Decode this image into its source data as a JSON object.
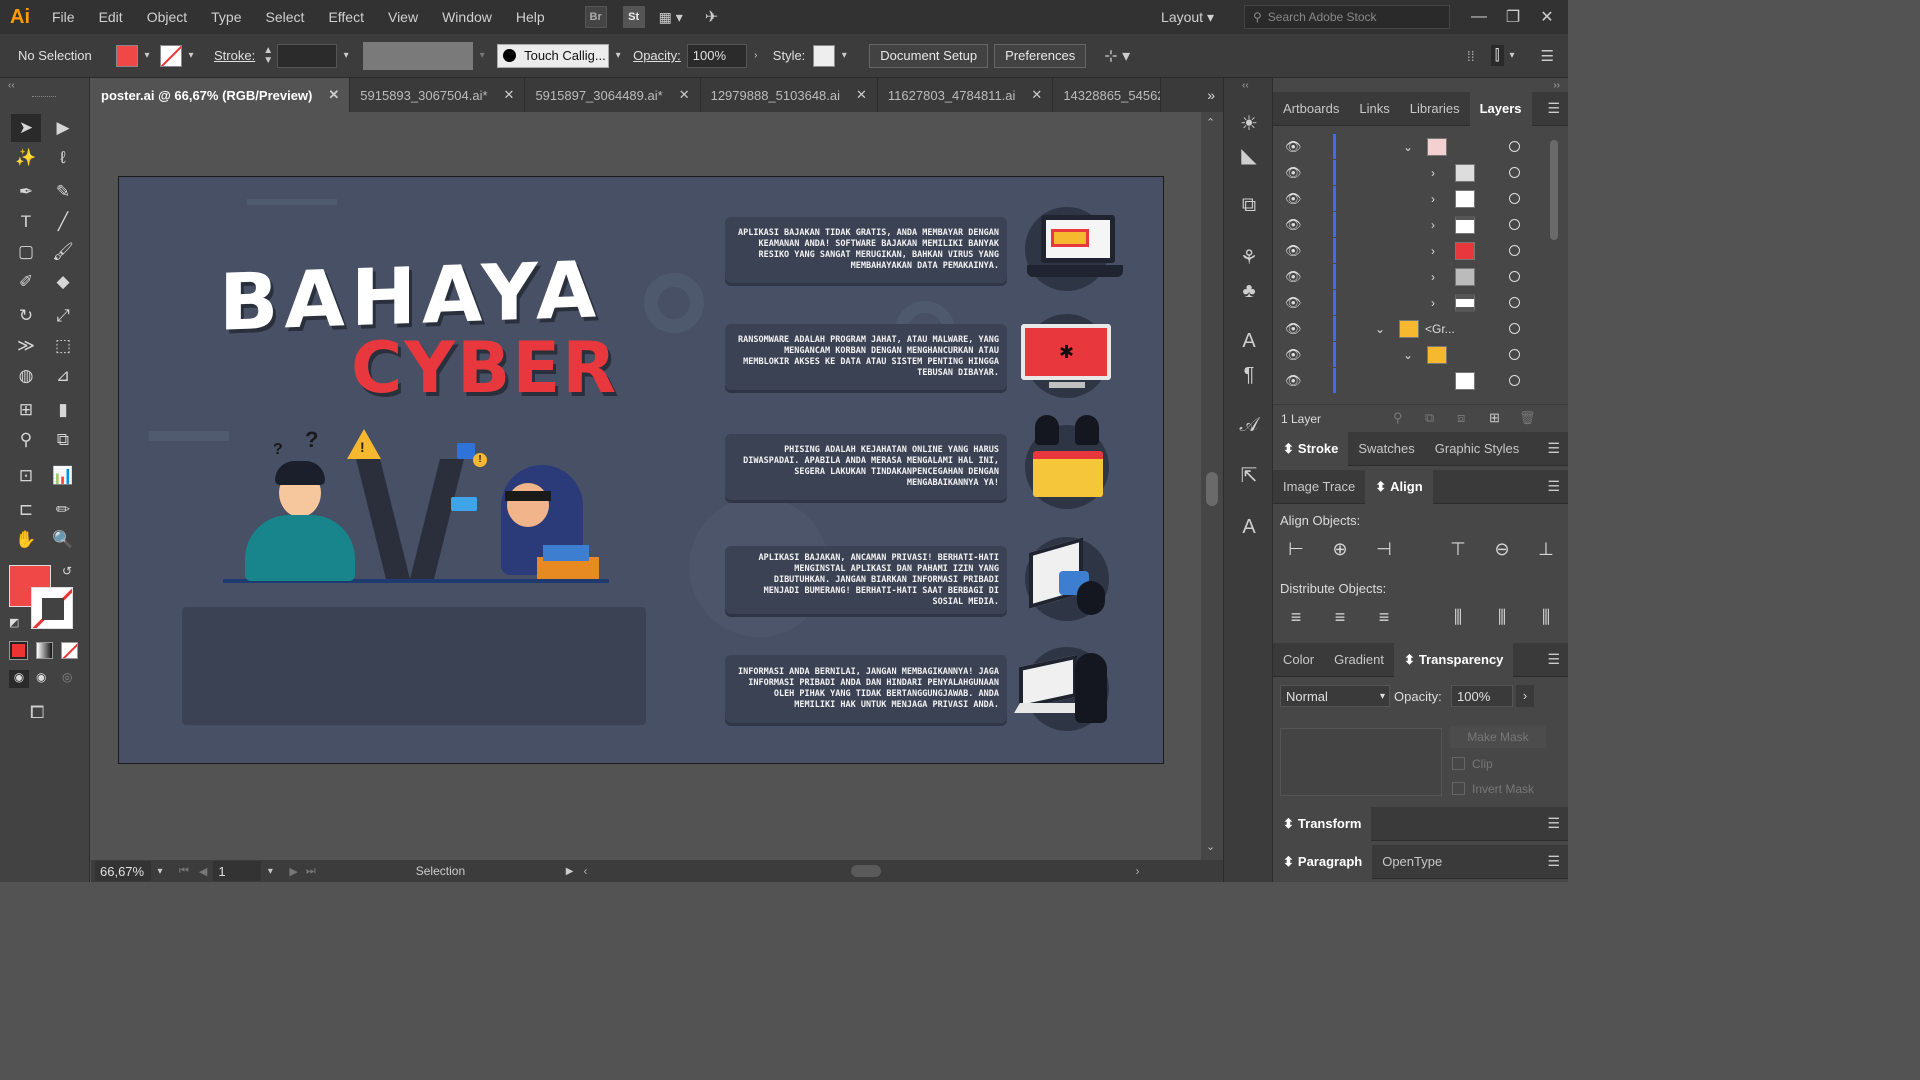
{
  "app": {
    "logo": "Ai",
    "menus": [
      "File",
      "Edit",
      "Object",
      "Type",
      "Select",
      "Effect",
      "View",
      "Window",
      "Help"
    ],
    "br": "Br",
    "st": "St",
    "layout": "Layout",
    "search_placeholder": "Search Adobe Stock"
  },
  "control": {
    "selection": "No Selection",
    "stroke_label": "Stroke:",
    "brush": "Touch Callig...",
    "opacity_label": "Opacity:",
    "opacity_value": "100%",
    "style_label": "Style:",
    "document_setup": "Document Setup",
    "preferences": "Preferences"
  },
  "tabs": [
    {
      "label": "poster.ai @ 66,67% (RGB/Preview)",
      "active": true
    },
    {
      "label": "5915893_3067504.ai*"
    },
    {
      "label": "5915897_3064489.ai*"
    },
    {
      "label": "12979888_5103648.ai"
    },
    {
      "label": "11627803_4784811.ai"
    },
    {
      "label": "14328865_54562"
    }
  ],
  "status": {
    "zoom": "66,67%",
    "page": "1",
    "tool": "Selection"
  },
  "poster": {
    "title_line1": "BAHAYA",
    "title_line2": "CYBER",
    "boxes": [
      "Aplikasi bajakan tidak gratis, Anda membayar dengan keamanan Anda! Software bajakan memiliki banyak resiko yang sangat merugikan, bahkan virus yang membahayakan data pemakainya.",
      "Ransomware adalah program jahat, atau malware, yang mengancam korban dengan menghancurkan atau memblokir akses ke data atau sistem penting hingga tebusan dibayar.",
      "Phising adalah kejahatan online yang harus diwaspadai. Apabila anda merasa mengalami hal ini, segera lakukan tindakanpencegahan dengan mengabaikannya ya!",
      "Aplikasi bajakan, ancaman privasi! Berhati-hati menginstal aplikasi dan pahami izin yang dibutuhkan. Jangan biarkan informasi pribadi menjadi bumerang! Berhati-hati saat berbagi di sosial media.",
      "Informasi Anda Bernilai, Jangan Membagikannya! Jaga informasi pribadi Anda dan hindari penyalahgunaan oleh pihak yang tidak bertanggungjawab. Anda memiliki hak untuk menjaga privasi Anda."
    ]
  },
  "panels": {
    "top_tabs": [
      "Artboards",
      "Links",
      "Libraries",
      "Layers"
    ],
    "layer_group_label": "<Gr...",
    "layer_count": "1 Layer",
    "stroke_tabs": [
      "Stroke",
      "Swatches",
      "Graphic Styles"
    ],
    "trace_tabs": [
      "Image Trace",
      "Align"
    ],
    "align_objects": "Align Objects:",
    "distribute_objects": "Distribute Objects:",
    "color_tabs": [
      "Color",
      "Gradient",
      "Transparency"
    ],
    "blend_mode": "Normal",
    "opacity_label": "Opacity:",
    "opacity_value": "100%",
    "make_mask": "Make Mask",
    "clip": "Clip",
    "invert_mask": "Invert Mask",
    "transform": "Transform",
    "paragraph_tabs": [
      "Paragraph",
      "OpenType"
    ]
  },
  "colors": {
    "fill": "#f04747",
    "accent_red": "#e8383d",
    "poster_bg": "#475065",
    "layer_bar": "#3c6ee8"
  }
}
